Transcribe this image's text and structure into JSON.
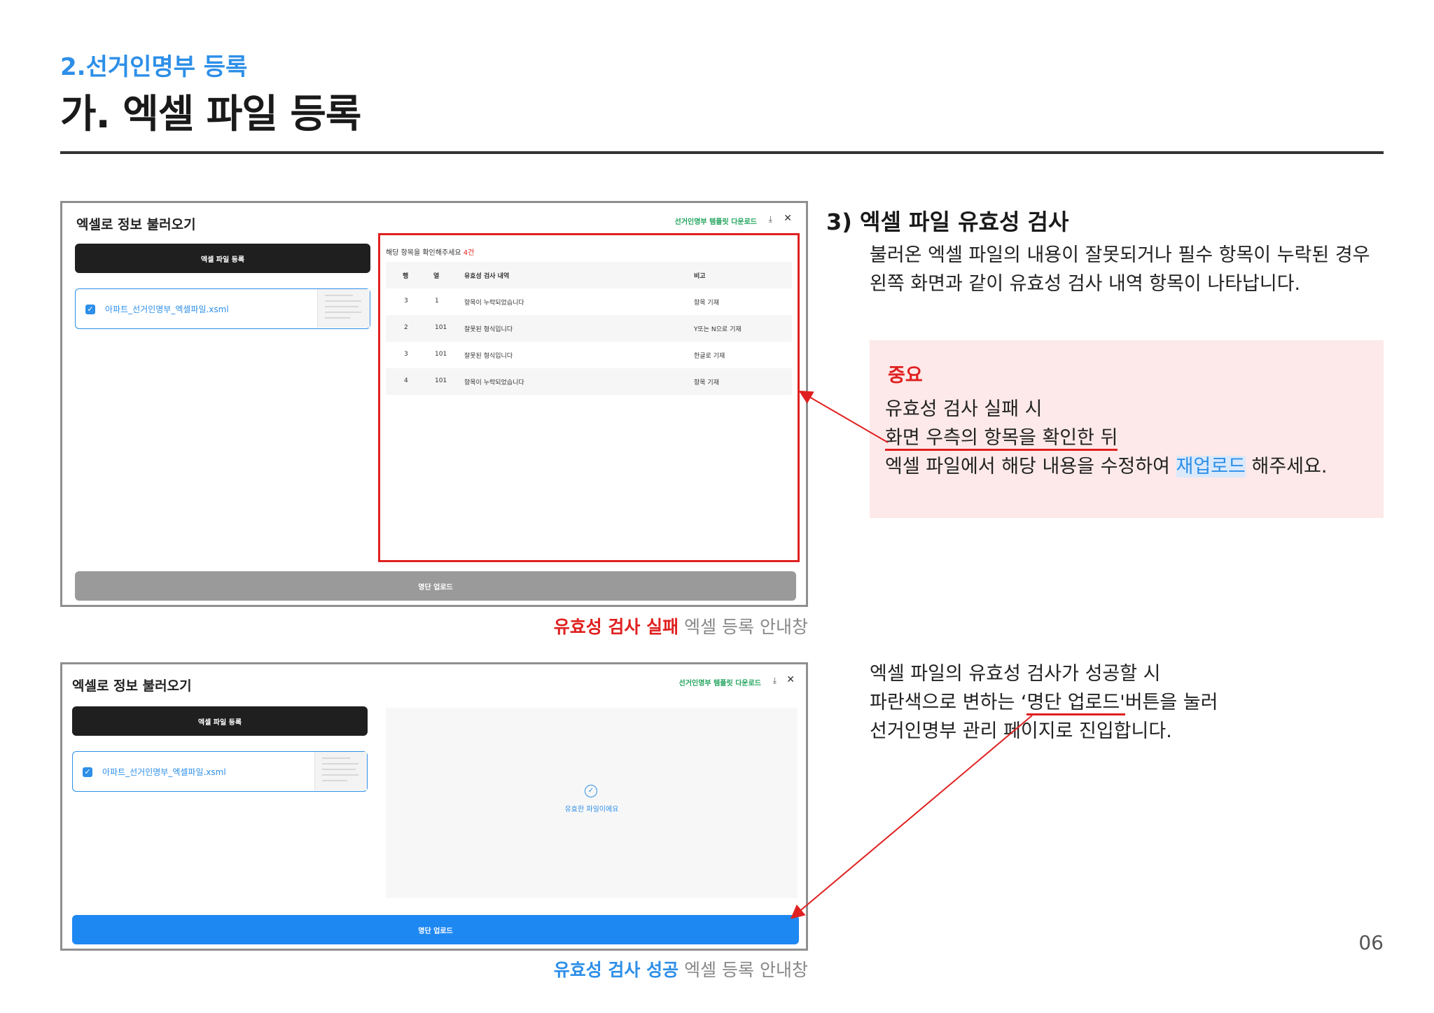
{
  "header": {
    "section_label": "2.선거인명부 등록",
    "page_title": "가. 엑셀 파일 등록"
  },
  "modal": {
    "title": "엑셀로 정보 불러오기",
    "template_link": "선거인명부 템플릿 다운로드",
    "register_button": "엑셀 파일 등록",
    "file_name": "아파트_선거인명부_엑셀파일.xsml",
    "upload_button": "명단 업로드"
  },
  "error_panel": {
    "prompt": "해당 항목을 확인해주세요",
    "count": "4건",
    "columns": [
      "행",
      "열",
      "유효성 검사 내역",
      "비고"
    ],
    "rows": [
      {
        "row": "3",
        "col": "1",
        "detail": "항목이 누락되었습니다",
        "note": "항목 기재"
      },
      {
        "row": "2",
        "col": "101",
        "detail": "잘못된 형식입니다",
        "note": "Y또는 N으로 기재"
      },
      {
        "row": "3",
        "col": "101",
        "detail": "잘못된 형식입니다",
        "note": "한글로 기재"
      },
      {
        "row": "4",
        "col": "101",
        "detail": "항목이 누락되었습니다",
        "note": "항목 기재"
      }
    ]
  },
  "valid_panel": {
    "message": "유효한 파일이에요"
  },
  "captions": {
    "fail_emph": "유효성 검사 실패",
    "fail_rest": "엑셀 등록 안내창",
    "ok_emph": "유효성 검사 성공",
    "ok_rest": "엑셀 등록 안내창"
  },
  "explain": {
    "sub_title": "3) 엑셀 파일 유효성 검사",
    "intro_line1": "불러온 엑셀 파일의 내용이 잘못되거나 필수 항목이 누락된 경우",
    "intro_line2": "왼쪽 화면과 같이 유효성 검사 내역 항목이 나타납니다.",
    "important_title": "중요",
    "important_line1": "유효성 검사 실패 시",
    "important_line2": "화면 우측의 항목을 확인한 뒤",
    "important_line3_a": "엑셀 파일에서 해당 내용을 수정하여 ",
    "important_line3_hl": "재업로드",
    "important_line3_b": " 해주세요.",
    "success_line1": "엑셀 파일의 유효성 검사가 성공할 시",
    "success_line2_a": "파란색으로 변하는 ‘",
    "success_line2_ul": "명단 업로드'",
    "success_line2_b": "버튼을 눌러",
    "success_line3": "선거인명부 관리 페이지로 진입합니다."
  },
  "page_number": "06",
  "colors": {
    "accent_blue": "#2d8fe8",
    "error_red": "#e02020",
    "important_bg": "#fde9e9"
  }
}
